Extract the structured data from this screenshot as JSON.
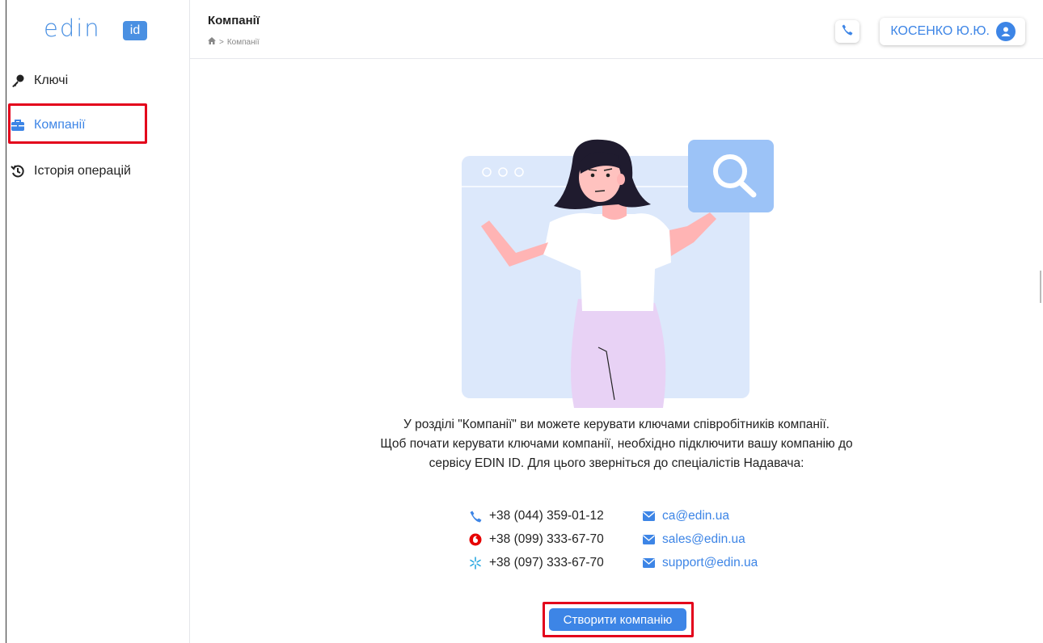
{
  "app": {
    "logo_text": "edin",
    "logo_badge": "id"
  },
  "sidebar": {
    "items": [
      {
        "label": "Ключі",
        "icon": "key-icon"
      },
      {
        "label": "Компанії",
        "icon": "briefcase-icon",
        "active": true
      },
      {
        "label": "Історія операцій",
        "icon": "history-icon"
      }
    ]
  },
  "header": {
    "title": "Компанії",
    "breadcrumb": [
      {
        "icon": "home-icon"
      },
      {
        "label": "Компанії"
      }
    ],
    "user_name": "КОСЕНКО Ю.Ю."
  },
  "main": {
    "info_lines": [
      "У розділі \"Компанії\" ви можете керувати ключами співробітників компанії.",
      "Щоб почати керувати ключами компанії, необхідно підключити вашу компанію до",
      "сервісу EDIN ID. Для цього зверніться до спеціалістів Надавача:"
    ],
    "contacts": [
      {
        "phone": "+38 (044) 359-01-12",
        "phone_icon": "phone-icon",
        "email": "ca@edin.ua"
      },
      {
        "phone": "+38 (099) 333-67-70",
        "phone_icon": "vodafone-icon",
        "email": "sales@edin.ua"
      },
      {
        "phone": "+38 (097) 333-67-70",
        "phone_icon": "kyivstar-icon",
        "email": "support@edin.ua"
      }
    ],
    "create_button": "Створити компанію"
  },
  "colors": {
    "accent": "#3d85e6",
    "highlight": "#e3001b",
    "vodafone": "#e60000",
    "kyivstar": "#2aa8e0"
  }
}
